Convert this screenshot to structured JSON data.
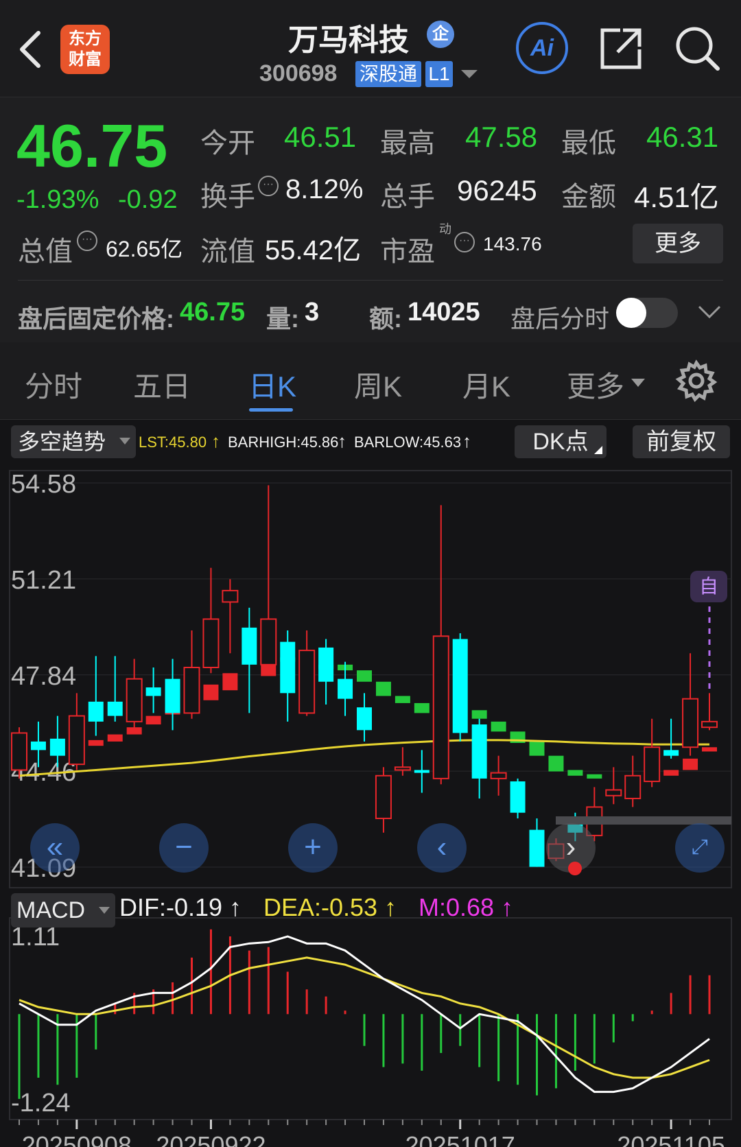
{
  "header": {
    "logo_text_1": "东方",
    "logo_text_2": "财富",
    "title": "万马科技",
    "enterprise_badge": "企",
    "code": "300698",
    "market_badge": "深股通",
    "level_badge": "L1",
    "ai_label": "Ai"
  },
  "quote": {
    "price": "46.75",
    "change_pct": "-1.93%",
    "change": "-0.92",
    "open_label": "今开",
    "open": "46.51",
    "high_label": "最高",
    "high": "47.58",
    "low_label": "最低",
    "low": "46.31",
    "turnover_label": "换手",
    "turnover": "8.12%",
    "volume_label": "总手",
    "volume": "96245",
    "amount_label": "金额",
    "amount": "4.51亿",
    "mktcap_label": "总值",
    "mktcap": "62.65亿",
    "float_label": "流值",
    "float_cap": "55.42亿",
    "pe_label": "市盈",
    "pe_sup": "动",
    "pe": "143.76",
    "more_button": "更多"
  },
  "afterhours": {
    "label": "盘后固定价格:",
    "price": "46.75",
    "vol_label": "量:",
    "vol": "3",
    "amt_label": "额:",
    "amt": "14025",
    "toggle_label": "盘后分时"
  },
  "tabs": [
    "分时",
    "五日",
    "日K",
    "周K",
    "月K",
    "更多"
  ],
  "active_tab": "日K",
  "indicator_bar": {
    "indicator": "多空趋势",
    "lst": "LST:45.80",
    "barhigh": "BARHIGH:45.86",
    "barlow": "BARLOW:45.63",
    "dk_button": "DK点",
    "adjust_button": "前复权",
    "self_label": "自"
  },
  "macd_bar": {
    "indicator": "MACD",
    "dif": "DIF:-0.19",
    "dea": "DEA:-0.53",
    "m": "M:0.68"
  },
  "colors": {
    "up": "#e8262a",
    "down_cyan": "#00ffff",
    "down_green": "#24c93c",
    "ma_line": "#e8d530",
    "accent": "#4c8fe8",
    "dea": "#f0e040",
    "m": "#ee3ae9"
  },
  "chart_data": [
    {
      "type": "candlestick",
      "y_ticks": [
        "54.58",
        "51.21",
        "47.84",
        "44.46",
        "41.09"
      ],
      "ylim": [
        41.09,
        54.58
      ],
      "x_ticks": [
        "20250908",
        "20250922",
        "20251017",
        "20251105"
      ],
      "candles": [
        {
          "o": 44.5,
          "c": 45.8,
          "h": 46.0,
          "l": 44.2,
          "s": "red"
        },
        {
          "o": 45.5,
          "c": 45.2,
          "h": 46.2,
          "l": 44.6,
          "s": "cyan"
        },
        {
          "o": 45.6,
          "c": 45.0,
          "h": 46.4,
          "l": 44.6,
          "s": "cyan"
        },
        {
          "o": 44.7,
          "c": 46.4,
          "h": 47.2,
          "l": 44.5,
          "s": "red"
        },
        {
          "o": 46.9,
          "c": 46.2,
          "h": 48.5,
          "l": 45.7,
          "s": "cyan"
        },
        {
          "o": 46.9,
          "c": 46.4,
          "h": 48.5,
          "l": 46.2,
          "s": "cyan"
        },
        {
          "o": 46.2,
          "c": 47.7,
          "h": 48.4,
          "l": 45.9,
          "s": "red"
        },
        {
          "o": 47.4,
          "c": 47.1,
          "h": 48.1,
          "l": 46.5,
          "s": "cyan"
        },
        {
          "o": 47.7,
          "c": 46.5,
          "h": 48.4,
          "l": 45.9,
          "s": "cyan"
        },
        {
          "o": 46.5,
          "c": 48.1,
          "h": 49.4,
          "l": 46.3,
          "s": "red"
        },
        {
          "o": 48.1,
          "c": 49.8,
          "h": 51.6,
          "l": 47.9,
          "s": "red"
        },
        {
          "o": 50.8,
          "c": 50.4,
          "h": 51.2,
          "l": 48.6,
          "s": "red"
        },
        {
          "o": 49.5,
          "c": 48.2,
          "h": 50.2,
          "l": 46.5,
          "s": "cyan"
        },
        {
          "o": 48.2,
          "c": 49.8,
          "h": 54.5,
          "l": 48.1,
          "s": "red"
        },
        {
          "o": 49.0,
          "c": 47.2,
          "h": 49.4,
          "l": 46.2,
          "s": "cyan"
        },
        {
          "o": 46.5,
          "c": 48.7,
          "h": 49.4,
          "l": 46.4,
          "s": "red"
        },
        {
          "o": 48.8,
          "c": 47.6,
          "h": 49.1,
          "l": 46.8,
          "s": "cyan"
        },
        {
          "o": 47.7,
          "c": 47.0,
          "h": 48.3,
          "l": 46.4,
          "s": "cyan"
        },
        {
          "o": 46.7,
          "c": 45.9,
          "h": 47.2,
          "l": 45.5,
          "s": "cyan"
        },
        {
          "o": 42.8,
          "c": 44.3,
          "h": 44.6,
          "l": 42.3,
          "s": "red"
        },
        {
          "o": 44.6,
          "c": 44.5,
          "h": 45.3,
          "l": 44.3,
          "s": "red"
        },
        {
          "o": 44.5,
          "c": 44.4,
          "h": 45.2,
          "l": 43.7,
          "s": "cyan"
        },
        {
          "o": 44.2,
          "c": 49.2,
          "h": 53.8,
          "l": 44.0,
          "s": "red"
        },
        {
          "o": 49.1,
          "c": 45.8,
          "h": 49.3,
          "l": 45.5,
          "s": "cyan"
        },
        {
          "o": 46.1,
          "c": 44.2,
          "h": 46.3,
          "l": 43.5,
          "s": "cyan"
        },
        {
          "o": 44.2,
          "c": 44.4,
          "h": 45.0,
          "l": 43.6,
          "s": "red"
        },
        {
          "o": 44.1,
          "c": 43.0,
          "h": 44.2,
          "l": 42.8,
          "s": "cyan"
        },
        {
          "o": 42.4,
          "c": 41.1,
          "h": 42.8,
          "l": 41.1,
          "s": "cyan"
        },
        {
          "o": 41.4,
          "c": 41.9,
          "h": 42.1,
          "l": 41.3,
          "s": "red"
        },
        {
          "o": 42.7,
          "c": 42.3,
          "h": 43.0,
          "l": 42.0,
          "s": "cyan"
        },
        {
          "o": 42.2,
          "c": 43.2,
          "h": 43.9,
          "l": 42.0,
          "s": "red"
        },
        {
          "o": 43.6,
          "c": 43.8,
          "h": 44.6,
          "l": 43.3,
          "s": "red"
        },
        {
          "o": 43.5,
          "c": 44.3,
          "h": 45.0,
          "l": 43.2,
          "s": "red"
        },
        {
          "o": 44.1,
          "c": 45.3,
          "h": 46.3,
          "l": 43.9,
          "s": "red"
        },
        {
          "o": 45.2,
          "c": 45.0,
          "h": 46.3,
          "l": 44.9,
          "s": "cyan"
        },
        {
          "o": 45.3,
          "c": 47.0,
          "h": 48.6,
          "l": 45.0,
          "s": "red"
        },
        {
          "o": 46.0,
          "c": 46.2,
          "h": 47.2,
          "l": 45.9,
          "s": "red"
        }
      ],
      "ma_line": [
        44.3,
        44.35,
        44.4,
        44.45,
        44.5,
        44.55,
        44.6,
        44.65,
        44.7,
        44.75,
        44.82,
        44.9,
        44.98,
        45.05,
        45.12,
        45.2,
        45.27,
        45.33,
        45.38,
        45.42,
        45.46,
        45.49,
        45.52,
        45.54,
        45.55,
        45.55,
        45.54,
        45.52,
        45.5,
        45.47,
        45.45,
        45.43,
        45.42,
        45.4,
        45.4,
        45.4,
        45.4
      ],
      "trend_blocks": [
        {
          "i": 4,
          "top": 45.55,
          "bot": 45.35,
          "s": "red"
        },
        {
          "i": 5,
          "top": 45.75,
          "bot": 45.5,
          "s": "red"
        },
        {
          "i": 6,
          "top": 46.0,
          "bot": 45.75,
          "s": "red"
        },
        {
          "i": 7,
          "top": 46.4,
          "bot": 46.1,
          "s": "red"
        },
        {
          "i": 8,
          "top": 46.7,
          "bot": 46.45,
          "s": "red"
        },
        {
          "i": 9,
          "top": 47.1,
          "bot": 46.75,
          "s": "red"
        },
        {
          "i": 10,
          "top": 47.5,
          "bot": 46.95,
          "s": "red"
        },
        {
          "i": 11,
          "top": 47.9,
          "bot": 47.3,
          "s": "red"
        },
        {
          "i": 13,
          "top": 48.3,
          "bot": 47.8,
          "s": "red"
        },
        {
          "i": 14,
          "top": 48.45,
          "bot": 48.3,
          "s": "green"
        },
        {
          "i": 16,
          "top": 48.2,
          "bot": 48.05,
          "s": "green"
        },
        {
          "i": 17,
          "top": 48.2,
          "bot": 48.0,
          "s": "green"
        },
        {
          "i": 18,
          "top": 48.0,
          "bot": 47.6,
          "s": "green"
        },
        {
          "i": 19,
          "top": 47.6,
          "bot": 47.1,
          "s": "green"
        },
        {
          "i": 20,
          "top": 47.1,
          "bot": 46.85,
          "s": "green"
        },
        {
          "i": 21,
          "top": 46.85,
          "bot": 46.5,
          "s": "green"
        },
        {
          "i": 22,
          "top": 46.7,
          "bot": 46.3,
          "s": "red"
        },
        {
          "i": 24,
          "top": 46.6,
          "bot": 46.3,
          "s": "green"
        },
        {
          "i": 25,
          "top": 46.2,
          "bot": 45.85,
          "s": "green"
        },
        {
          "i": 26,
          "top": 45.85,
          "bot": 45.45,
          "s": "green"
        },
        {
          "i": 27,
          "top": 45.5,
          "bot": 45.0,
          "s": "green"
        },
        {
          "i": 28,
          "top": 45.0,
          "bot": 44.45,
          "s": "green"
        },
        {
          "i": 29,
          "top": 44.5,
          "bot": 44.3,
          "s": "green"
        },
        {
          "i": 30,
          "top": 44.35,
          "bot": 44.2,
          "s": "green"
        },
        {
          "i": 32,
          "top": 44.2,
          "bot": 44.0,
          "s": "green"
        },
        {
          "i": 33,
          "top": 44.3,
          "bot": 44.1,
          "s": "red"
        },
        {
          "i": 34,
          "top": 44.5,
          "bot": 44.3,
          "s": "red"
        },
        {
          "i": 35,
          "top": 44.9,
          "bot": 44.5,
          "s": "red"
        },
        {
          "i": 36,
          "top": 45.3,
          "bot": 45.15,
          "s": "red"
        }
      ]
    },
    {
      "type": "macd",
      "y_ticks": [
        "1.11",
        "-1.24"
      ],
      "ylim": [
        -1.24,
        1.11
      ],
      "dif": [
        0.15,
        0.0,
        -0.15,
        -0.15,
        0.05,
        0.15,
        0.25,
        0.3,
        0.3,
        0.45,
        0.65,
        0.95,
        1.0,
        1.02,
        1.1,
        1.0,
        1.0,
        0.9,
        0.7,
        0.5,
        0.35,
        0.2,
        0.0,
        -0.2,
        0.0,
        -0.05,
        -0.1,
        -0.3,
        -0.6,
        -0.9,
        -1.1,
        -1.1,
        -1.05,
        -0.9,
        -0.75,
        -0.55,
        -0.35
      ],
      "dea": [
        0.2,
        0.1,
        0.05,
        0.0,
        0.0,
        0.05,
        0.1,
        0.12,
        0.2,
        0.3,
        0.4,
        0.55,
        0.65,
        0.7,
        0.75,
        0.8,
        0.75,
        0.7,
        0.6,
        0.5,
        0.4,
        0.3,
        0.25,
        0.15,
        0.1,
        0.0,
        -0.15,
        -0.3,
        -0.45,
        -0.6,
        -0.75,
        -0.85,
        -0.9,
        -0.9,
        -0.85,
        -0.75,
        -0.65
      ],
      "bars": [
        -1.2,
        -0.9,
        -1.0,
        -0.9,
        -0.5,
        0.15,
        0.3,
        0.35,
        0.45,
        0.8,
        1.2,
        1.1,
        0.9,
        0.95,
        0.6,
        0.35,
        0.25,
        0.05,
        -0.45,
        -0.75,
        -0.7,
        -0.8,
        -0.55,
        -0.45,
        -0.75,
        -0.95,
        -1.0,
        -1.15,
        -1.05,
        -0.8,
        -0.7,
        -0.4,
        -0.1,
        0.05,
        0.3,
        0.55,
        0.55
      ]
    }
  ]
}
